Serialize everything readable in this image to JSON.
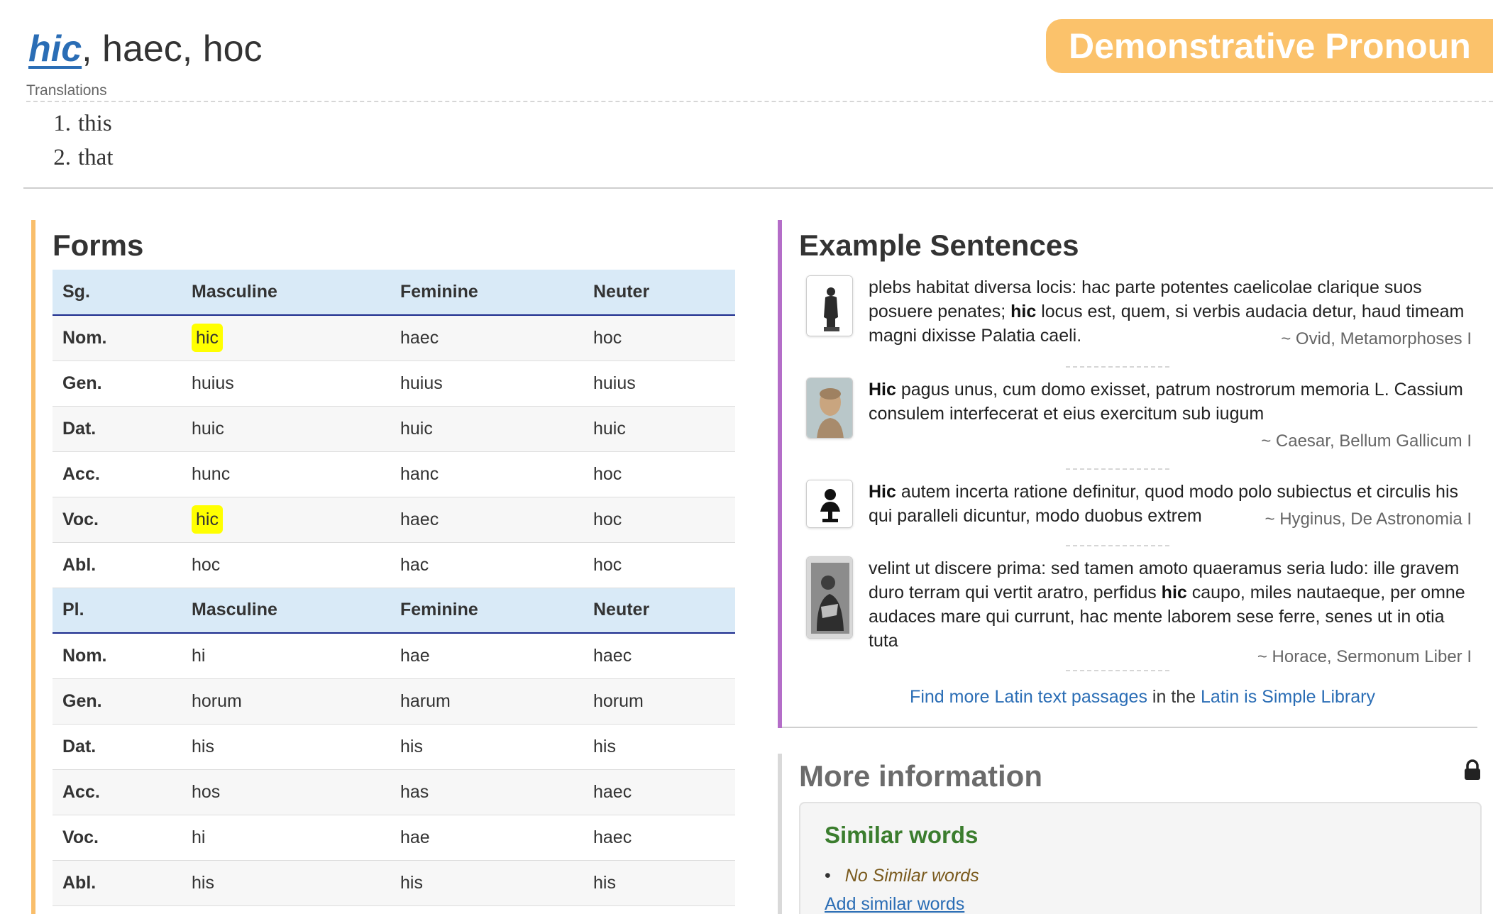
{
  "header": {
    "lemma_link": "hic",
    "lemma_rest": ", haec, hoc",
    "part_of_speech": "Demonstrative Pronoun",
    "translations_label": "Translations",
    "translations": [
      {
        "num": "1.",
        "text": "this"
      },
      {
        "num": "2.",
        "text": "that"
      }
    ]
  },
  "forms": {
    "title": "Forms",
    "singular_header": [
      "Sg.",
      "Masculine",
      "Feminine",
      "Neuter"
    ],
    "singular_rows": [
      {
        "case": "Nom.",
        "m": "hic",
        "f": "haec",
        "n": "hoc"
      },
      {
        "case": "Gen.",
        "m": "huius",
        "f": "huius",
        "n": "huius"
      },
      {
        "case": "Dat.",
        "m": "huic",
        "f": "huic",
        "n": "huic"
      },
      {
        "case": "Acc.",
        "m": "hunc",
        "f": "hanc",
        "n": "hoc"
      },
      {
        "case": "Voc.",
        "m": "hic",
        "f": "haec",
        "n": "hoc"
      },
      {
        "case": "Abl.",
        "m": "hoc",
        "f": "hac",
        "n": "hoc"
      }
    ],
    "plural_header": [
      "Pl.",
      "Masculine",
      "Feminine",
      "Neuter"
    ],
    "plural_rows": [
      {
        "case": "Nom.",
        "m": "hi",
        "f": "hae",
        "n": "haec"
      },
      {
        "case": "Gen.",
        "m": "horum",
        "f": "harum",
        "n": "horum"
      },
      {
        "case": "Dat.",
        "m": "his",
        "f": "his",
        "n": "his"
      },
      {
        "case": "Acc.",
        "m": "hos",
        "f": "has",
        "n": "haec"
      },
      {
        "case": "Voc.",
        "m": "hi",
        "f": "hae",
        "n": "haec"
      },
      {
        "case": "Abl.",
        "m": "his",
        "f": "his",
        "n": "his"
      }
    ]
  },
  "examples": {
    "title": "Example Sentences",
    "items": [
      {
        "thumb": "statue-icon",
        "before": "plebs habitat diversa locis: hac parte potentes caelicolae clarique suos posuere penates; ",
        "bold": "hic",
        "after": " locus est, quem, si verbis audacia detur, haud timeam magni dixisse Palatia caeli.",
        "source": "~ Ovid, Metamorphoses I"
      },
      {
        "thumb": "bust-portrait-icon",
        "before": "",
        "bold": "Hic",
        "after": " pagus unus, cum domo exisset, patrum nostrorum memoria L. Cassium consulem interfecerat et eius exercitum sub iugum",
        "source": "~ Caesar, Bellum Gallicum I"
      },
      {
        "thumb": "person-silhouette-icon",
        "before": "",
        "bold": "Hic",
        "after": " autem incerta ratione definitur, quod modo polo subiectus et circulis his qui paralleli dicuntur, modo duobus extrem",
        "source": "~ Hyginus, De Astronomia I"
      },
      {
        "thumb": "engraving-portrait-icon",
        "before": "velint ut discere prima: sed tamen amoto quaeramus seria ludo: ille gravem duro terram qui vertit aratro, perfidus ",
        "bold": "hic",
        "after": " caupo, miles nautaeque, per omne audaces mare qui currunt, hac mente laborem sese ferre, senes ut in otia tuta",
        "source": "~ Horace, Sermonum Liber I"
      }
    ],
    "more_link": "Find more Latin text passages",
    "more_mid": " in the ",
    "library_link": "Latin is Simple Library"
  },
  "more_info": {
    "title": "More information",
    "lock_icon": "lock-icon",
    "similar_title": "Similar words",
    "similar_items": [
      "No Similar words"
    ],
    "add_similar": "Add similar words"
  },
  "colors": {
    "accent_orange": "#f9be6b",
    "accent_purple": "#b46dc8",
    "link_blue": "#2a6db5",
    "highlight_yellow": "#ffff00",
    "table_header_bg": "#d9eaf7",
    "similar_green": "#3b7d2e"
  }
}
